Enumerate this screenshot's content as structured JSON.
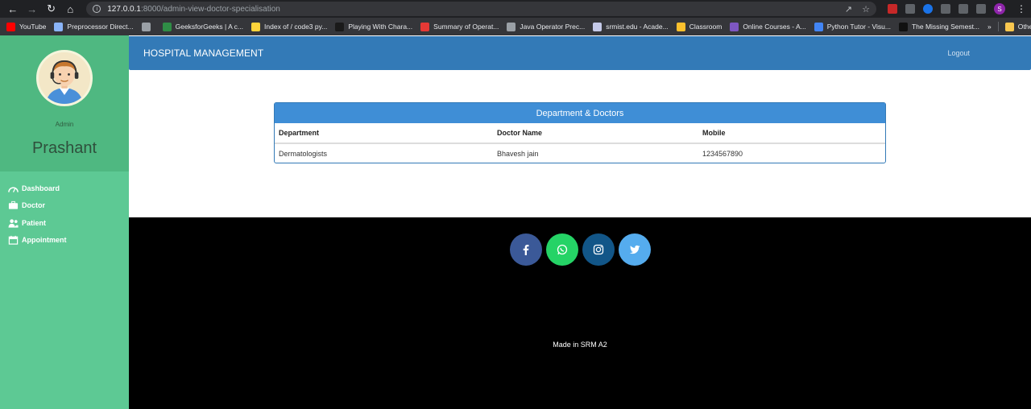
{
  "browser": {
    "url_host": "127.0.0.1",
    "url_path": ":8000/admin-view-doctor-specialisation",
    "profile_initial": "S",
    "bookmarks": [
      {
        "label": "YouTube",
        "color": "#ff0000"
      },
      {
        "label": "Preprocessor Direct...",
        "color": "#8ab4f8"
      },
      {
        "label": "",
        "color": "#9aa0a6"
      },
      {
        "label": "GeeksforGeeks | A c...",
        "color": "#2f8d46"
      },
      {
        "label": "Index of / code3 py...",
        "color": "#ffd43b"
      },
      {
        "label": "Playing With Chara...",
        "color": "#1a1a1a"
      },
      {
        "label": "Summary of Operat...",
        "color": "#e53935"
      },
      {
        "label": "Java Operator Prec...",
        "color": "#9aa0a6"
      },
      {
        "label": "srmist.edu - Acade...",
        "color": "#c5cae9"
      },
      {
        "label": "Classroom",
        "color": "#fbc02d"
      },
      {
        "label": "Online Courses - A...",
        "color": "#7e57c2"
      },
      {
        "label": "Python Tutor - Visu...",
        "color": "#4285f4"
      },
      {
        "label": "The Missing Semest...",
        "color": "#111111"
      }
    ],
    "more_label": "»",
    "other_bookmarks": "Other bookmarks"
  },
  "sidebar": {
    "role": "Admin",
    "username": "Prashant",
    "items": [
      {
        "label": "Dashboard",
        "icon": "dashboard-icon"
      },
      {
        "label": "Doctor",
        "icon": "briefcase-icon"
      },
      {
        "label": "Patient",
        "icon": "users-icon"
      },
      {
        "label": "Appointment",
        "icon": "calendar-icon"
      }
    ]
  },
  "header": {
    "title": "HOSPITAL MANAGEMENT",
    "logout": "Logout"
  },
  "panel": {
    "title": "Department & Doctors",
    "columns": [
      "Department",
      "Doctor Name",
      "Mobile"
    ],
    "rows": [
      [
        "Dermatologists",
        "Bhavesh jain",
        "1234567890"
      ]
    ]
  },
  "footer": {
    "socials": [
      {
        "name": "facebook-icon",
        "color": "#3b5998"
      },
      {
        "name": "whatsapp-icon",
        "color": "#25d366"
      },
      {
        "name": "instagram-icon",
        "color": "#125688"
      },
      {
        "name": "twitter-icon",
        "color": "#55acee"
      }
    ],
    "made_in": "Made in SRM A2"
  }
}
